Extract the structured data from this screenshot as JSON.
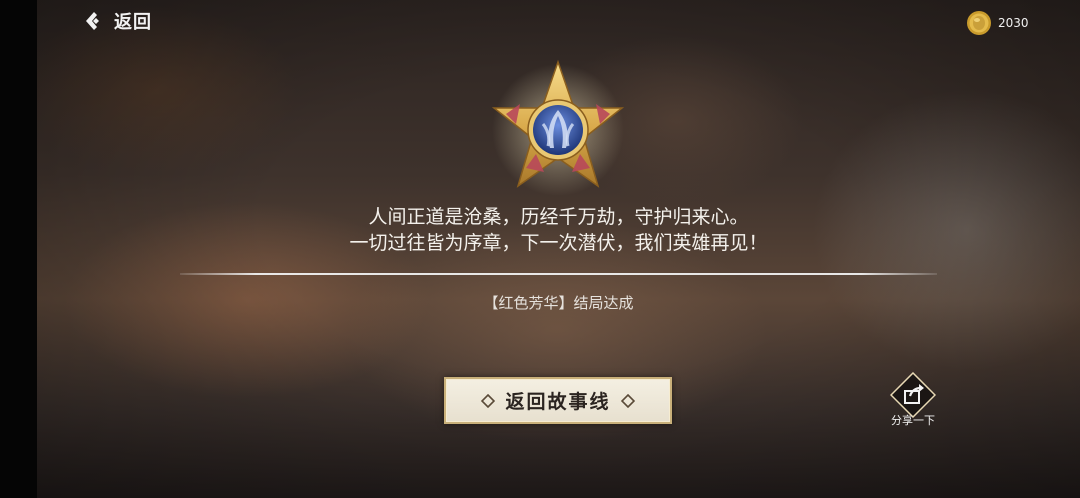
{
  "header": {
    "back_label": "返回",
    "back_icon": "chevron-left-diamond-icon",
    "coin_icon": "gold-coin-icon",
    "coin_value": "2030"
  },
  "medal": {
    "icon": "gold-star-medal-icon"
  },
  "ending": {
    "line1": "人间正道是沧桑，历经千万劫，守护归来心。",
    "line2": "一切过往皆为序章，下一次潜伏，我们英雄再见！",
    "achievement": "【红色芳华】结局达成"
  },
  "actions": {
    "story_button_label": "返回故事线",
    "share_label": "分享一下",
    "share_icon": "share-arrow-icon"
  },
  "colors": {
    "button_bg": "#f4efe2",
    "button_border": "#c9b07a",
    "medal_gold": "#e1b85a",
    "medal_blue": "#2d4fa0",
    "text": "#f4f1ec"
  }
}
